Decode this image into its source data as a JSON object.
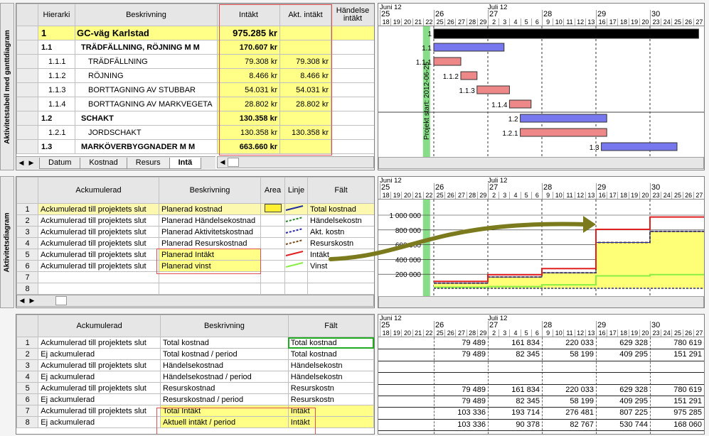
{
  "side_labels": {
    "top": "Aktivitetstabell med ganttdiagram",
    "middle": "Aktivitetsdiagram"
  },
  "top_table": {
    "headers": [
      "Hierarki",
      "Beskrivning",
      "Intäkt",
      "Akt. intäkt",
      "Händelse intäkt"
    ],
    "rows": [
      {
        "h": "1",
        "d": "GC-väg Karlstad",
        "i": "975.285 kr",
        "a": ""
      },
      {
        "h": "1.1",
        "d": "TRÄDFÄLLNING, RÖJNING M M",
        "i": "170.607 kr",
        "a": ""
      },
      {
        "h": "1.1.1",
        "d": "TRÄDFÄLLNING",
        "i": "79.308 kr",
        "a": "79.308 kr"
      },
      {
        "h": "1.1.2",
        "d": "RÖJNING",
        "i": "8.466 kr",
        "a": "8.466 kr"
      },
      {
        "h": "1.1.3",
        "d": "BORTTAGNING AV STUBBAR",
        "i": "54.031 kr",
        "a": "54.031 kr"
      },
      {
        "h": "1.1.4",
        "d": "BORTTAGNING AV MARKVEGETA",
        "i": "28.802 kr",
        "a": "28.802 kr"
      },
      {
        "h": "1.2",
        "d": "SCHAKT",
        "i": "130.358 kr",
        "a": ""
      },
      {
        "h": "1.2.1",
        "d": "JORDSCHAKT",
        "i": "130.358 kr",
        "a": "130.358 kr"
      },
      {
        "h": "1.3",
        "d": "MARKÖVERBYGGNADER M M",
        "i": "663.660 kr",
        "a": ""
      }
    ],
    "tabs": [
      "Datum",
      "Kostnad",
      "Resurs",
      "Intä"
    ]
  },
  "timescale": {
    "months": [
      "Juni 12",
      "Juli 12"
    ],
    "weeks": [
      "25",
      "26",
      "27",
      "28",
      "29",
      "30"
    ],
    "days": [
      "18",
      "19",
      "20",
      "21",
      "22",
      "25",
      "26",
      "27",
      "28",
      "29",
      "2",
      "3",
      "4",
      "5",
      "6",
      "9",
      "10",
      "11",
      "12",
      "13",
      "16",
      "17",
      "18",
      "19",
      "20",
      "23",
      "24",
      "25",
      "26",
      "27"
    ]
  },
  "gantt": {
    "project_start": "Projekt start: 2012-06-25",
    "bar_labels": [
      "1",
      "1.1",
      "1.1.1",
      "1.1.2",
      "1.1.3",
      "1.1.4",
      "1.2",
      "1.2.1",
      "1.3"
    ],
    "colors": {
      "summary": "#000000",
      "parent": "#7777ee",
      "task": "#ee8888",
      "start_line": "#88dd88"
    }
  },
  "mid_table": {
    "headers": [
      "Ackumulerad",
      "Beskrivning",
      "Area",
      "Linje",
      "Fält"
    ],
    "rows": [
      {
        "n": "1",
        "a": "Ackumulerad till projektets slut",
        "d": "Planerad kostnad",
        "f": "Total kostnad",
        "color": "#1f2f9f",
        "dash": false
      },
      {
        "n": "2",
        "a": "Ackumulerad till projektets slut",
        "d": "Planerad Händelsekostnad",
        "f": "Händelsekostn",
        "color": "#2a8a2a",
        "dash": true
      },
      {
        "n": "3",
        "a": "Ackumulerad till projektets slut",
        "d": "Planerad Aktivitetskostnad",
        "f": "Akt. kostn",
        "color": "#2a2ab0",
        "dash": true
      },
      {
        "n": "4",
        "a": "Ackumulerad till projektets slut",
        "d": "Planerad Resurskostnad",
        "f": "Resurskostn",
        "color": "#7a4a1a",
        "dash": true
      },
      {
        "n": "5",
        "a": "Ackumulerad till projektets slut",
        "d": "Planerad Intäkt",
        "f": "Intäkt",
        "color": "#e02020",
        "dash": false
      },
      {
        "n": "6",
        "a": "Ackumulerad till projektets slut",
        "d": "Planerad vinst",
        "f": "Vinst",
        "color": "#88ee44",
        "dash": false
      },
      {
        "n": "7",
        "a": "",
        "d": "",
        "f": "",
        "color": "",
        "dash": false
      },
      {
        "n": "8",
        "a": "",
        "d": "",
        "f": "",
        "color": "",
        "dash": false
      }
    ]
  },
  "chart_data": {
    "type": "line",
    "yticks": [
      "1 000 000",
      "800 000",
      "600 000",
      "400 000",
      "200 000"
    ],
    "ylim": [
      0,
      1000000
    ],
    "periods": [
      "v26",
      "v27",
      "v28",
      "v29",
      "v30"
    ],
    "series": [
      {
        "name": "Intäkt",
        "values": [
          103336,
          193714,
          276481,
          807225,
          975285
        ]
      },
      {
        "name": "Total kostnad",
        "values": [
          79489,
          161834,
          220033,
          629328,
          780619
        ]
      },
      {
        "name": "Vinst",
        "values": [
          23847,
          31880,
          56448,
          177897,
          194666
        ]
      }
    ]
  },
  "bot_table": {
    "headers": [
      "Ackumulerad",
      "Beskrivning",
      "Fält"
    ],
    "rows": [
      {
        "n": "1",
        "a": "Ackumulerad till projektets slut",
        "d": "Total kostnad",
        "f": "Total kostnad",
        "v": [
          "79 489",
          "161 834",
          "220 033",
          "629 328",
          "780 619"
        ]
      },
      {
        "n": "2",
        "a": "Ej ackumulerad",
        "d": "Total kostnad / period",
        "f": "Total kostnad",
        "v": [
          "79 489",
          "82 345",
          "58 199",
          "409 295",
          "151 291"
        ]
      },
      {
        "n": "3",
        "a": "Ackumulerad till projektets slut",
        "d": "Händelsekostnad",
        "f": "Händelsekostn",
        "v": [
          "",
          "",
          "",
          "",
          ""
        ]
      },
      {
        "n": "4",
        "a": "Ej ackumulerad",
        "d": "Händelsekostnad / period",
        "f": "Händelsekostn",
        "v": [
          "",
          "",
          "",
          "",
          ""
        ]
      },
      {
        "n": "5",
        "a": "Ackumulerad till projektets slut",
        "d": "Resurskostnad",
        "f": "Resurskostn",
        "v": [
          "79 489",
          "161 834",
          "220 033",
          "629 328",
          "780 619"
        ]
      },
      {
        "n": "6",
        "a": "Ej ackumulerad",
        "d": "Resurskostnad / period",
        "f": "Resurskostn",
        "v": [
          "79 489",
          "82 345",
          "58 199",
          "409 295",
          "151 291"
        ]
      },
      {
        "n": "7",
        "a": "Ackumulerad till projektets slut",
        "d": "Total Intäkt",
        "f": "Intäkt",
        "v": [
          "103 336",
          "193 714",
          "276 481",
          "807 225",
          "975 285"
        ]
      },
      {
        "n": "8",
        "a": "Ej ackumulerad",
        "d": "Aktuell intäkt / period",
        "f": "Intäkt",
        "v": [
          "103 336",
          "90 378",
          "82 767",
          "530 744",
          "168 060"
        ]
      }
    ]
  }
}
